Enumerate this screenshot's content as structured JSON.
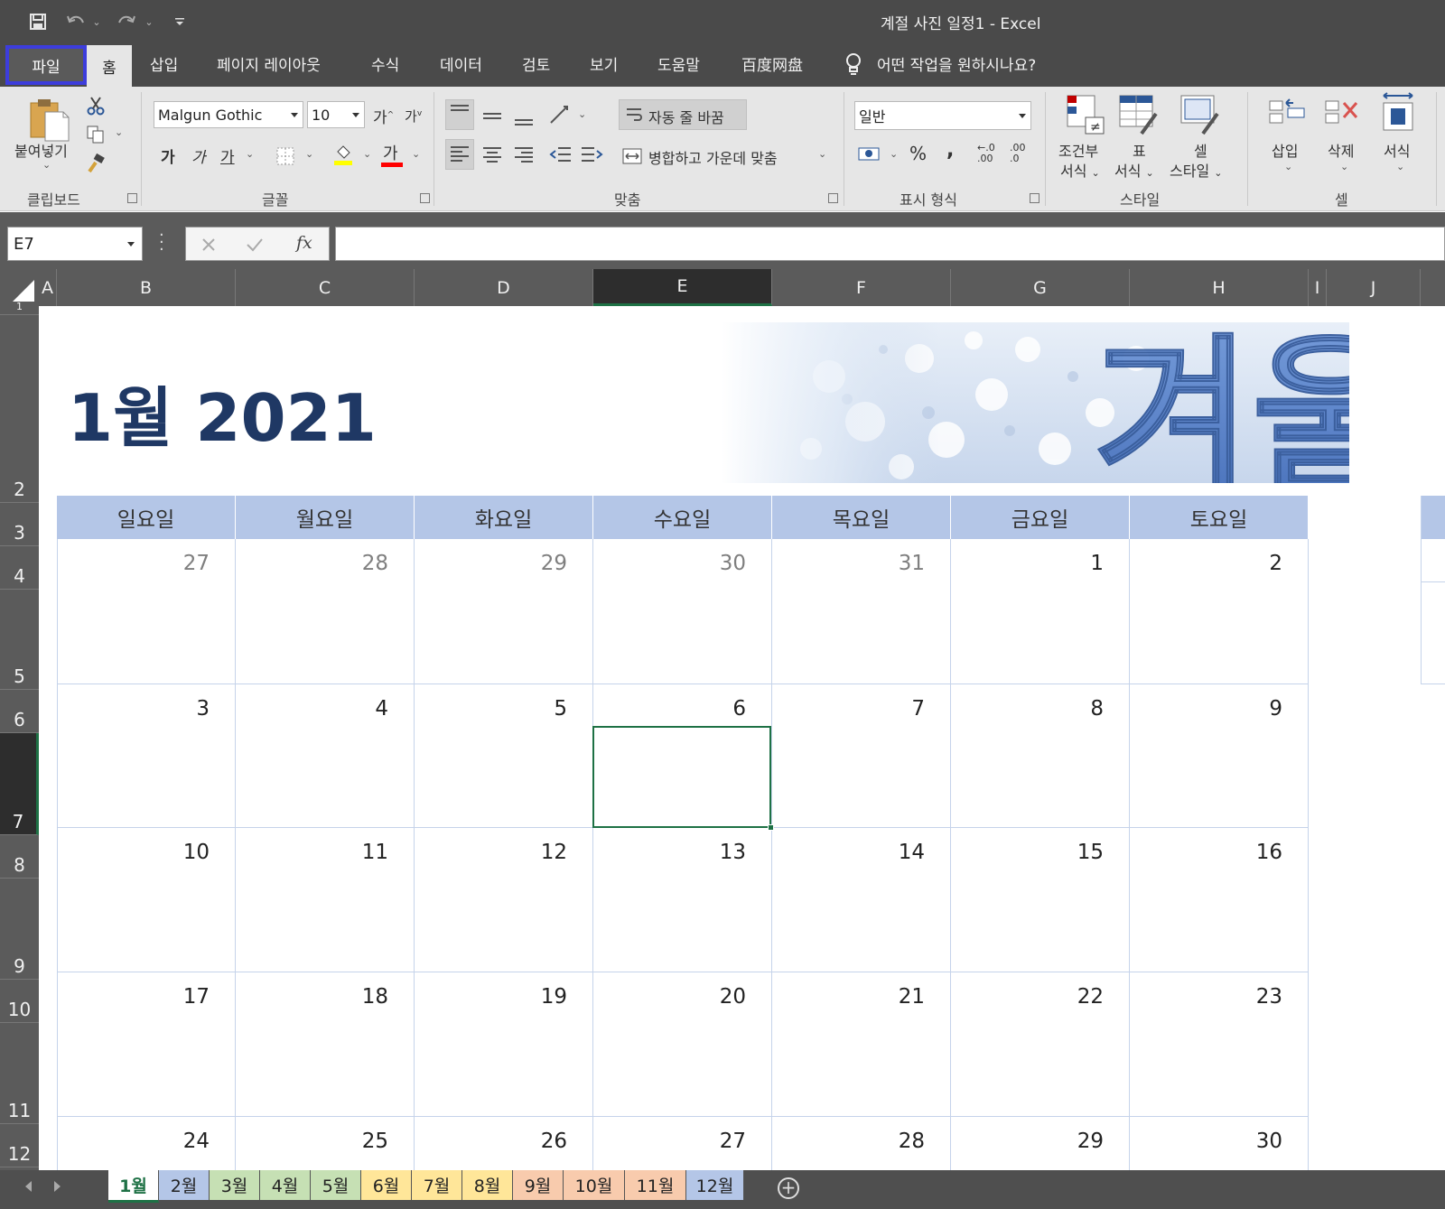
{
  "window": {
    "title": "계절 사진 일정1  -  Excel"
  },
  "ribbon_tabs": [
    "파일",
    "홈",
    "삽입",
    "페이지 레이아웃",
    "수식",
    "데이터",
    "검토",
    "보기",
    "도움말",
    "百度网盘"
  ],
  "tell_me": "어떤 작업을 원하시나요?",
  "clipboard": {
    "paste": "붙여넣기",
    "label": "클립보드"
  },
  "font": {
    "name": "Malgun Gothic",
    "size": "10",
    "bold": "가",
    "italic": "가",
    "underline": "가",
    "grow": "가",
    "shrink": "가",
    "color_glyph": "가",
    "label": "글꼴"
  },
  "alignment": {
    "wrap": "자동 줄 바꿈",
    "merge": "병합하고 가운데 맞춤",
    "label": "맞춤"
  },
  "number": {
    "format": "일반",
    "percent": "%",
    "comma": ",",
    "inc": ".00",
    "dec": ".0",
    "inc_top": "←.0",
    "dec_top": ".00",
    "label": "표시 형식"
  },
  "styles": {
    "cond_1": "조건부",
    "cond_2": "서식",
    "table_1": "표",
    "table_2": "서식",
    "cell_1": "셀",
    "cell_2": "스타일",
    "label": "스타일"
  },
  "cells": {
    "insert": "삽입",
    "delete": "삭제",
    "format": "서식",
    "label": "셀"
  },
  "formula_bar": {
    "name_box": "E7",
    "fx": "fx",
    "value": ""
  },
  "columns": [
    "A",
    "B",
    "C",
    "D",
    "E",
    "F",
    "G",
    "H",
    "I",
    "J"
  ],
  "rows": [
    "1",
    "2",
    "3",
    "4",
    "5",
    "6",
    "7",
    "8",
    "9",
    "10",
    "11",
    "12"
  ],
  "calendar": {
    "title": "1월 2021",
    "banner_text": "겨울",
    "weekdays": [
      "일요일",
      "월요일",
      "화요일",
      "수요일",
      "목요일",
      "금요일",
      "토요일"
    ],
    "weeks": [
      [
        "27",
        "28",
        "29",
        "30",
        "31",
        "1",
        "2"
      ],
      [
        "3",
        "4",
        "5",
        "6",
        "7",
        "8",
        "9"
      ],
      [
        "10",
        "11",
        "12",
        "13",
        "14",
        "15",
        "16"
      ],
      [
        "17",
        "18",
        "19",
        "20",
        "21",
        "22",
        "23"
      ],
      [
        "24",
        "25",
        "26",
        "27",
        "28",
        "29",
        "30"
      ]
    ]
  },
  "sheet_tabs": [
    {
      "label": "1월",
      "color": "#ffffff"
    },
    {
      "label": "2월",
      "color": "#b4c6e7"
    },
    {
      "label": "3월",
      "color": "#c6e0b4"
    },
    {
      "label": "4월",
      "color": "#c6e0b4"
    },
    {
      "label": "5월",
      "color": "#c6e0b4"
    },
    {
      "label": "6월",
      "color": "#ffe699"
    },
    {
      "label": "7월",
      "color": "#ffe699"
    },
    {
      "label": "8월",
      "color": "#ffe699"
    },
    {
      "label": "9월",
      "color": "#f8cbad"
    },
    {
      "label": "10월",
      "color": "#f8cbad"
    },
    {
      "label": "11월",
      "color": "#f8cbad"
    },
    {
      "label": "12월",
      "color": "#b4c6e7"
    }
  ],
  "colors": {
    "accent": "#1e7145",
    "title_blue": "#1f3864",
    "header_fill": "#b4c6e7"
  }
}
